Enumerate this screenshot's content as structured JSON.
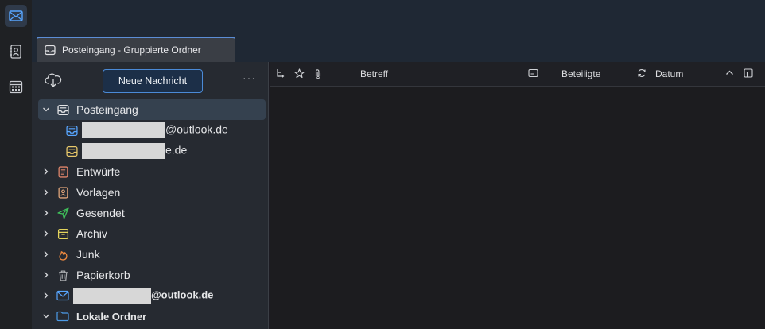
{
  "spaces": {
    "items": [
      {
        "name": "mail"
      },
      {
        "name": "address-book"
      },
      {
        "name": "calendar"
      }
    ]
  },
  "tab": {
    "label": "Posteingang - Gruppierte Ordner"
  },
  "folder_pane": {
    "new_message_label": "Neue Nachricht",
    "more_label": "···",
    "folders": {
      "inbox": "Posteingang",
      "account1_suffix": "@outlook.de",
      "account2_suffix": "e.de",
      "drafts": "Entwürfe",
      "templates": "Vorlagen",
      "sent": "Gesendet",
      "archive": "Archiv",
      "junk": "Junk",
      "trash": "Papierkorb",
      "account_suffix": "@outlook.de",
      "local_folders": "Lokale Ordner"
    }
  },
  "columns": {
    "subject": "Betreff",
    "correspondents": "Beteiligte",
    "date": "Datum"
  },
  "colors": {
    "accent": "#4b8ad6",
    "drafts": "#e0856a",
    "templates": "#e0a57a",
    "sent": "#3fbf5a",
    "archive": "#e3d45c",
    "junk": "#ef8a3f",
    "local": "#4c9be8"
  }
}
